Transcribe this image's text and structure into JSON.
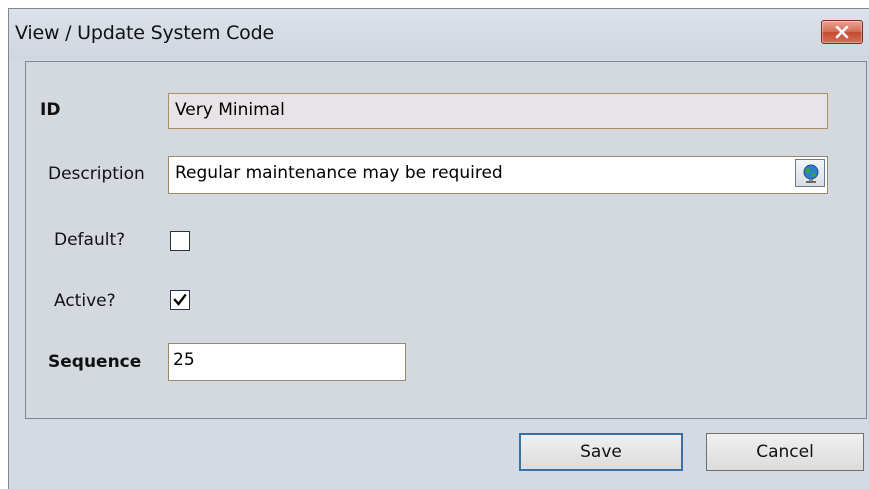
{
  "window": {
    "title": "View / Update System Code",
    "close_icon": "close-x-icon"
  },
  "form": {
    "id": {
      "label": "ID",
      "value": "Very Minimal"
    },
    "description": {
      "label": "Description",
      "value": "Regular maintenance may be required",
      "button_icon": "globe-icon"
    },
    "default": {
      "label": "Default?",
      "checked": false
    },
    "active": {
      "label": "Active?",
      "checked": true
    },
    "sequence": {
      "label": "Sequence",
      "value": "25"
    }
  },
  "buttons": {
    "save_label": "Save",
    "cancel_label": "Cancel"
  },
  "colors": {
    "window_bg": "#d4dae2",
    "close_button": "#c94a33",
    "readonly_field_bg": "#e8e3e7",
    "default_button_border": "#3c6fa8"
  }
}
